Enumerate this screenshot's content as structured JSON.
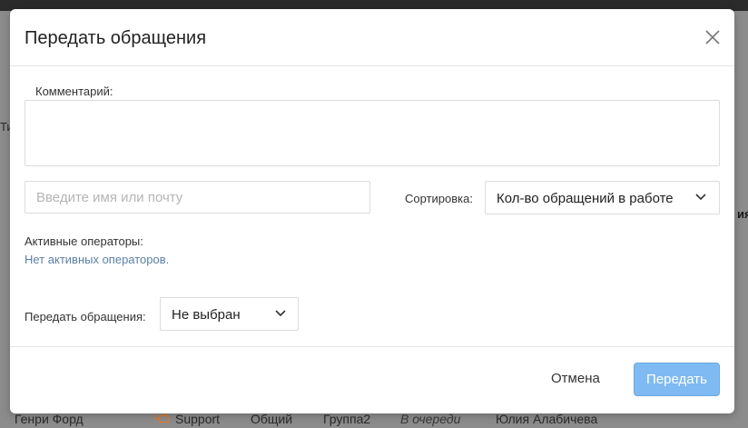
{
  "background": {
    "row": {
      "name": "Генри Форд",
      "channel": "Support",
      "type": "Общий",
      "group": "Группа2",
      "status": "В очереди",
      "operator": "Юлия Алабичева"
    },
    "left_edge_text": "Ти",
    "right_edge_text": "ия"
  },
  "modal": {
    "title": "Передать обращения",
    "comment_label": "Комментарий:",
    "comment_value": "",
    "search_placeholder": "Введите имя или почту",
    "sort_label": "Сортировка:",
    "sort_value": "Кол-во обращений в работе",
    "active_operators_label": "Активные операторы:",
    "no_operators_text": "Нет активных операторов.",
    "transfer_label": "Передать обращения:",
    "transfer_value": "Не выбран",
    "cancel_label": "Отмена",
    "submit_label": "Передать"
  },
  "colors": {
    "submit_button": "#7fbaf2",
    "hint_text": "#5b7fa6",
    "overlay": "#8c8c8c",
    "chat_icon": "#e07b2c"
  },
  "icons": {
    "close": "close-icon",
    "dropdown": "chevron-down-icon",
    "channel": "chat-bubbles-icon"
  }
}
